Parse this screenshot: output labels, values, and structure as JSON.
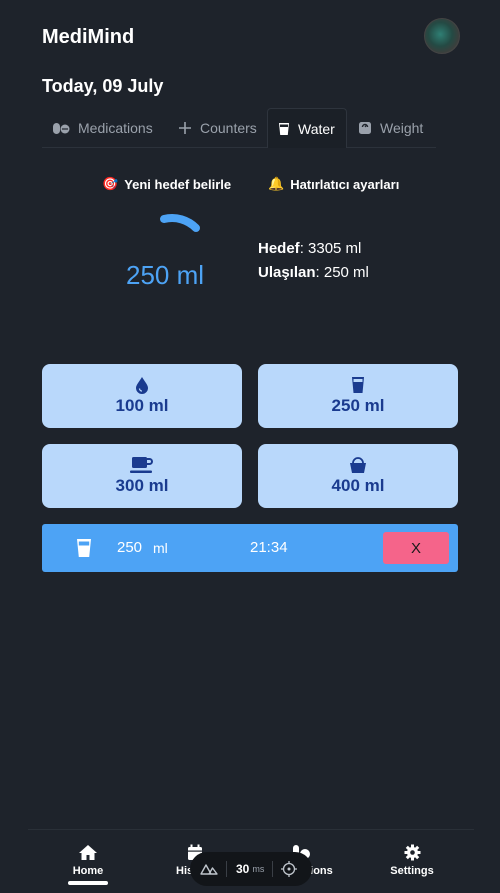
{
  "app": {
    "title": "MediMind",
    "date": "Today, 09 July"
  },
  "tabs": [
    {
      "label": "Medications",
      "icon": "pills-icon"
    },
    {
      "label": "Counters",
      "icon": "plus-icon"
    },
    {
      "label": "Water",
      "icon": "glass-icon",
      "active": true
    },
    {
      "label": "Weight",
      "icon": "scale-icon"
    }
  ],
  "actions": {
    "new_goal": "Yeni hedef belirle",
    "new_goal_emoji": "🎯",
    "reminders": "Hatırlatıcı ayarları",
    "reminders_emoji": "🔔"
  },
  "water": {
    "current": "250 ml",
    "goal_label": "Hedef",
    "goal_value": ": 3305 ml",
    "reached_label": "Ulaşılan",
    "reached_value": ": 250 ml",
    "progress_fraction": 0.076
  },
  "quick_add": [
    {
      "label": "100 ml",
      "icon": "drop-icon"
    },
    {
      "label": "250 ml",
      "icon": "glass-icon"
    },
    {
      "label": "300 ml",
      "icon": "mug-icon"
    },
    {
      "label": "400 ml",
      "icon": "bucket-icon"
    }
  ],
  "entries": [
    {
      "amount": "250",
      "unit": "ml",
      "time": "21:34",
      "delete_label": "X"
    }
  ],
  "nav": [
    {
      "label": "Home",
      "icon": "home-icon",
      "active": true
    },
    {
      "label": "History",
      "icon": "calendar-icon"
    },
    {
      "label": "Medications",
      "icon": "pills-icon"
    },
    {
      "label": "Settings",
      "icon": "gear-icon"
    }
  ],
  "devtools": {
    "value": "30",
    "unit": "ms"
  },
  "colors": {
    "background": "#1e232b",
    "accent": "#4da3f5",
    "button": "#b9d8fb",
    "button_text": "#1a3b8f",
    "delete": "#f5648a"
  }
}
